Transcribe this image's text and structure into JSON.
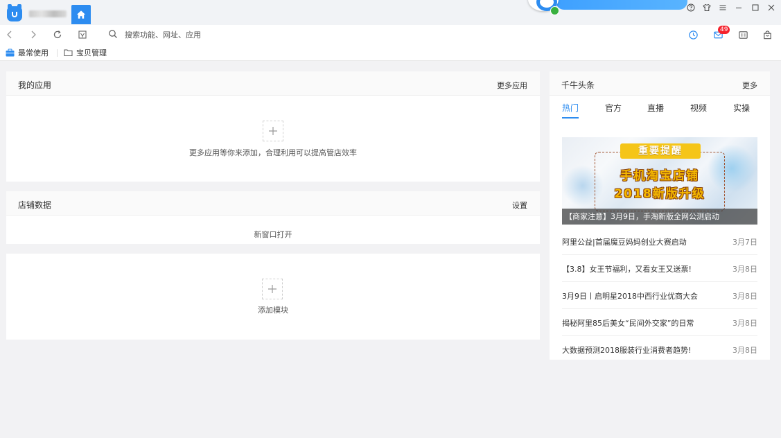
{
  "navbar": {
    "search_placeholder": "搜索功能、网址、应用",
    "mail_badge": "49"
  },
  "bookmarks": {
    "items": [
      {
        "label": "最常使用",
        "icon": "toolbox-icon"
      },
      {
        "label": "宝贝管理",
        "icon": "folder-icon"
      }
    ]
  },
  "my_apps": {
    "title": "我的应用",
    "more_label": "更多应用",
    "hint": "更多应用等你来添加，合理利用可以提高管店效率"
  },
  "store_data": {
    "title": "店铺数据",
    "settings_label": "设置",
    "open_label": "新窗口打开"
  },
  "add_module": {
    "label": "添加模块"
  },
  "news": {
    "title": "千牛头条",
    "more_label": "更多",
    "tabs": [
      {
        "label": "热门",
        "active": true
      },
      {
        "label": "官方",
        "active": false
      },
      {
        "label": "直播",
        "active": false
      },
      {
        "label": "视频",
        "active": false
      },
      {
        "label": "实操",
        "active": false
      }
    ],
    "banner": {
      "ribbon": "重要提醒",
      "line1": "手机淘宝店铺",
      "line2": "2018新版升级",
      "caption": "【商家注意】3月9日，手淘新版全网公测启动"
    },
    "items": [
      {
        "title": "阿里公益|首届魔豆妈妈创业大赛启动",
        "date": "3月7日"
      },
      {
        "title": "【3.8】女王节福利，又看女王又送票!",
        "date": "3月8日"
      },
      {
        "title": "3月9日丨启明星2018中西行业优商大会",
        "date": "3月8日"
      },
      {
        "title": "揭秘阿里85后美女“民间外交家”的日常",
        "date": "3月8日"
      },
      {
        "title": "大数据预测2018服装行业消费者趋势!",
        "date": "3月8日"
      }
    ]
  },
  "colors": {
    "accent": "#2d8cf0",
    "badge": "#f5222d"
  }
}
